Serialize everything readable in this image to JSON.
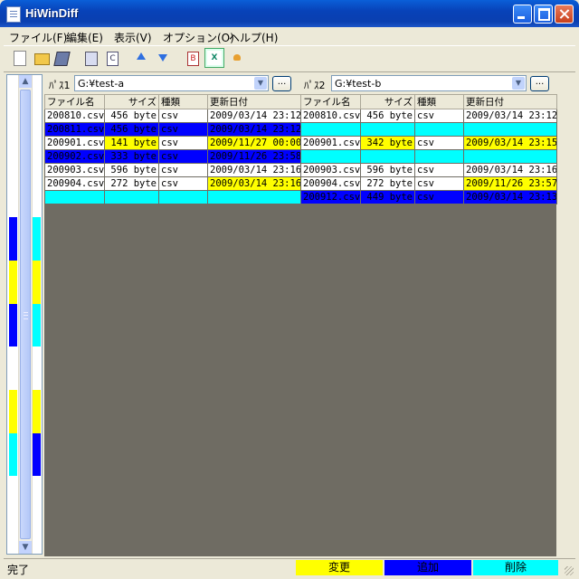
{
  "window": {
    "title": "HiWinDiff"
  },
  "menu": [
    "ファイル(F)",
    "編集(E)",
    "表示(V)",
    "オプション(O)",
    "ヘルプ(H)"
  ],
  "icons": {
    "new": "new-file-icon",
    "open": "open-folder-icon",
    "save": "save-icon",
    "copy1": "copy-left-icon",
    "copy2": "copy-right-icon",
    "prev": "prev-diff-arrow-icon",
    "next": "next-diff-arrow-icon",
    "text": "text-report-icon",
    "excel": "excel-export-icon",
    "settings": "settings-icon"
  },
  "toolbar": {
    "copy2_glyph": "C",
    "text_glyph": "B",
    "excel_glyph": "X"
  },
  "left": {
    "label": "ﾊﾟｽ1",
    "path": "G:¥test-a",
    "browse": "..."
  },
  "right": {
    "label": "ﾊﾟｽ2",
    "path": "G:¥test-b",
    "browse": "..."
  },
  "columns": [
    "ファイル名",
    "サイズ",
    "種類",
    "更新日付"
  ],
  "rows": [
    {
      "left": {
        "name": "200810.csv",
        "size": "456 byte",
        "type": "csv",
        "date": "2009/03/14 23:12",
        "colors": [
          "w",
          "w",
          "w",
          "w"
        ]
      },
      "right": {
        "name": "200810.csv",
        "size": "456 byte",
        "type": "csv",
        "date": "2009/03/14 23:12",
        "colors": [
          "w",
          "w",
          "w",
          "w"
        ]
      }
    },
    {
      "left": {
        "name": "200811.csv",
        "size": "456 byte",
        "type": "csv",
        "date": "2009/03/14 23:12",
        "colors": [
          "b",
          "b",
          "b",
          "b"
        ]
      },
      "right": {
        "name": "",
        "size": "",
        "type": "",
        "date": "",
        "colors": [
          "c",
          "c",
          "c",
          "c"
        ]
      }
    },
    {
      "left": {
        "name": "200901.csv",
        "size": "141 byte",
        "type": "csv",
        "date": "2009/11/27 00:00",
        "colors": [
          "w",
          "y",
          "w",
          "y"
        ]
      },
      "right": {
        "name": "200901.csv",
        "size": "342 byte",
        "type": "csv",
        "date": "2009/03/14 23:15",
        "colors": [
          "w",
          "y",
          "w",
          "y"
        ]
      }
    },
    {
      "left": {
        "name": "200902.csv",
        "size": "333 byte",
        "type": "csv",
        "date": "2009/11/26 23:58",
        "colors": [
          "b",
          "b",
          "b",
          "b"
        ]
      },
      "right": {
        "name": "",
        "size": "",
        "type": "",
        "date": "",
        "colors": [
          "c",
          "c",
          "c",
          "c"
        ]
      }
    },
    {
      "left": {
        "name": "200903.csv",
        "size": "596 byte",
        "type": "csv",
        "date": "2009/03/14 23:16",
        "colors": [
          "w",
          "w",
          "w",
          "w"
        ]
      },
      "right": {
        "name": "200903.csv",
        "size": "596 byte",
        "type": "csv",
        "date": "2009/03/14 23:16",
        "colors": [
          "w",
          "w",
          "w",
          "w"
        ]
      }
    },
    {
      "left": {
        "name": "200904.csv",
        "size": "272 byte",
        "type": "csv",
        "date": "2009/03/14 23:16",
        "colors": [
          "w",
          "w",
          "w",
          "y"
        ]
      },
      "right": {
        "name": "200904.csv",
        "size": "272 byte",
        "type": "csv",
        "date": "2009/11/26 23:57",
        "colors": [
          "w",
          "w",
          "w",
          "y"
        ]
      }
    },
    {
      "left": {
        "name": "",
        "size": "",
        "type": "",
        "date": "",
        "colors": [
          "c",
          "c",
          "c",
          "c"
        ]
      },
      "right": {
        "name": "200912.csv",
        "size": "449 byte",
        "type": "csv",
        "date": "2009/03/14 23:13",
        "colors": [
          "b",
          "b",
          "b",
          "b"
        ]
      }
    }
  ],
  "overview": {
    "left": [
      "w",
      "w",
      "w",
      "w",
      "w",
      "w",
      "b",
      "b",
      "y",
      "y",
      "b",
      "b",
      "w",
      "w",
      "y",
      "y",
      "c",
      "c",
      "w",
      "w",
      "w"
    ],
    "right": [
      "w",
      "w",
      "w",
      "w",
      "w",
      "w",
      "c",
      "c",
      "y",
      "y",
      "c",
      "c",
      "w",
      "w",
      "y",
      "y",
      "b",
      "b",
      "w",
      "w",
      "w"
    ]
  },
  "status": {
    "text": "完了",
    "legend_changed": "変更",
    "legend_added": "追加",
    "legend_deleted": "削除"
  },
  "colors": {
    "w": "#ffffff",
    "y": "#ffff00",
    "b": "#0000ff",
    "c": "#00ffff",
    "grid_bg": "#6f6c63"
  }
}
